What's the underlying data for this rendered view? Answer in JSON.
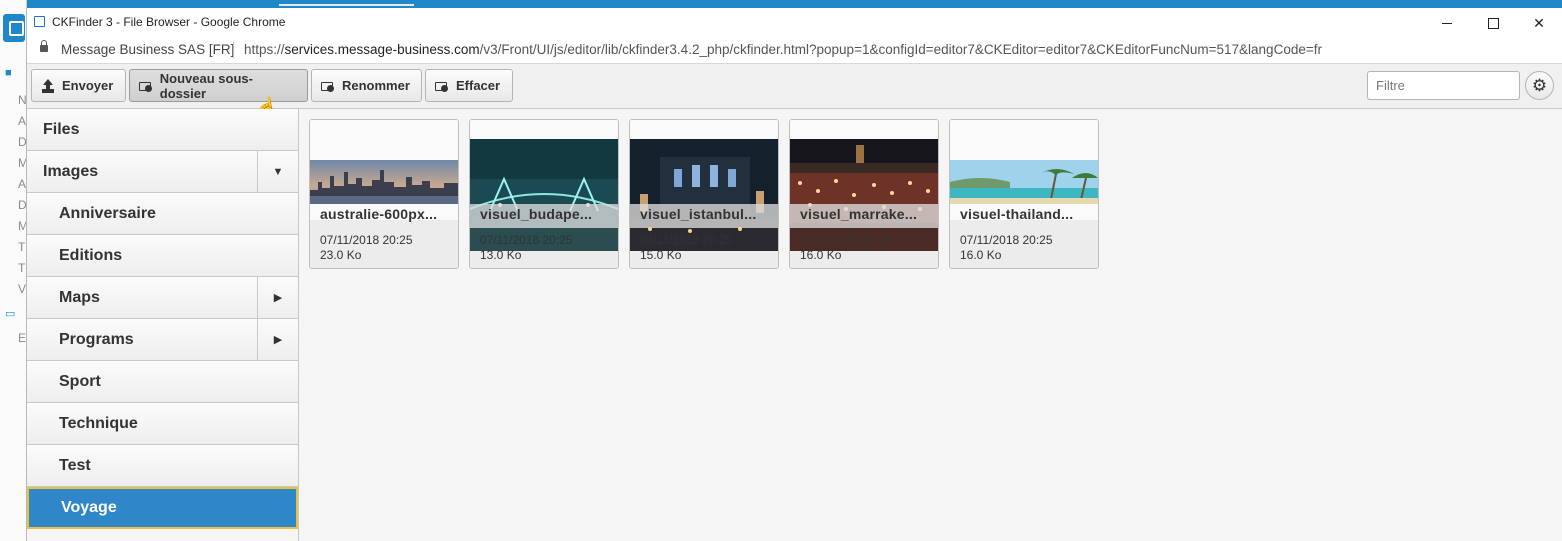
{
  "window": {
    "title": "CKFinder 3 - File Browser - Google Chrome",
    "site_name": "Message Business SAS [FR]",
    "url_scheme": "https://",
    "url_host": "services.message-business.com",
    "url_path": "/v3/Front/UI/js/editor/lib/ckfinder3.4.2_php/ckfinder.html?popup=1&configId=editor7&CKEditor=editor7&CKEditorFuncNum=517&langCode=fr",
    "minimize_glyph": "",
    "maximize_glyph": "",
    "close_glyph": "✕"
  },
  "toolbar": {
    "upload_label": "Envoyer",
    "new_folder_label": "Nouveau sous-dossier",
    "rename_label": "Renommer",
    "delete_label": "Effacer",
    "filter_placeholder": "Filtre",
    "settings_glyph": "⚙"
  },
  "sidebar": {
    "folders": [
      {
        "label": "Files",
        "level": 0,
        "toggle": ""
      },
      {
        "label": "Images",
        "level": 0,
        "toggle": "▼"
      },
      {
        "label": "Anniversaire",
        "level": 1,
        "toggle": ""
      },
      {
        "label": "Editions",
        "level": 1,
        "toggle": ""
      },
      {
        "label": "Maps",
        "level": 1,
        "toggle": "▶"
      },
      {
        "label": "Programs",
        "level": 1,
        "toggle": "▶"
      },
      {
        "label": "Sport",
        "level": 1,
        "toggle": ""
      },
      {
        "label": "Technique",
        "level": 1,
        "toggle": ""
      },
      {
        "label": "Test",
        "level": 1,
        "toggle": ""
      },
      {
        "label": "Voyage",
        "level": 1,
        "toggle": "",
        "selected": true
      }
    ]
  },
  "files": [
    {
      "name": "australie-600px...",
      "date": "07/11/2018 20:25",
      "size": "23.0 Ko",
      "theme": "sydney-skyline"
    },
    {
      "name": "visuel_budape...",
      "date": "07/11/2018 20:25",
      "size": "13.0 Ko",
      "theme": "budapest-bridge-night"
    },
    {
      "name": "visuel_istanbul...",
      "date": "07/11/2018 20:25",
      "size": "15.0 Ko",
      "theme": "istanbul-mosque-night"
    },
    {
      "name": "visuel_marrake...",
      "date": "07/11/2018 20:25",
      "size": "16.0 Ko",
      "theme": "marrakech-square-night"
    },
    {
      "name": "visuel-thailand...",
      "date": "07/11/2018 20:25",
      "size": "16.0 Ko",
      "theme": "thailand-beach"
    }
  ],
  "background_app": {
    "sidebar_letters": [
      "N",
      "A",
      "D",
      "M",
      "A",
      "D",
      "M",
      "T",
      "T",
      "V",
      "E"
    ]
  }
}
